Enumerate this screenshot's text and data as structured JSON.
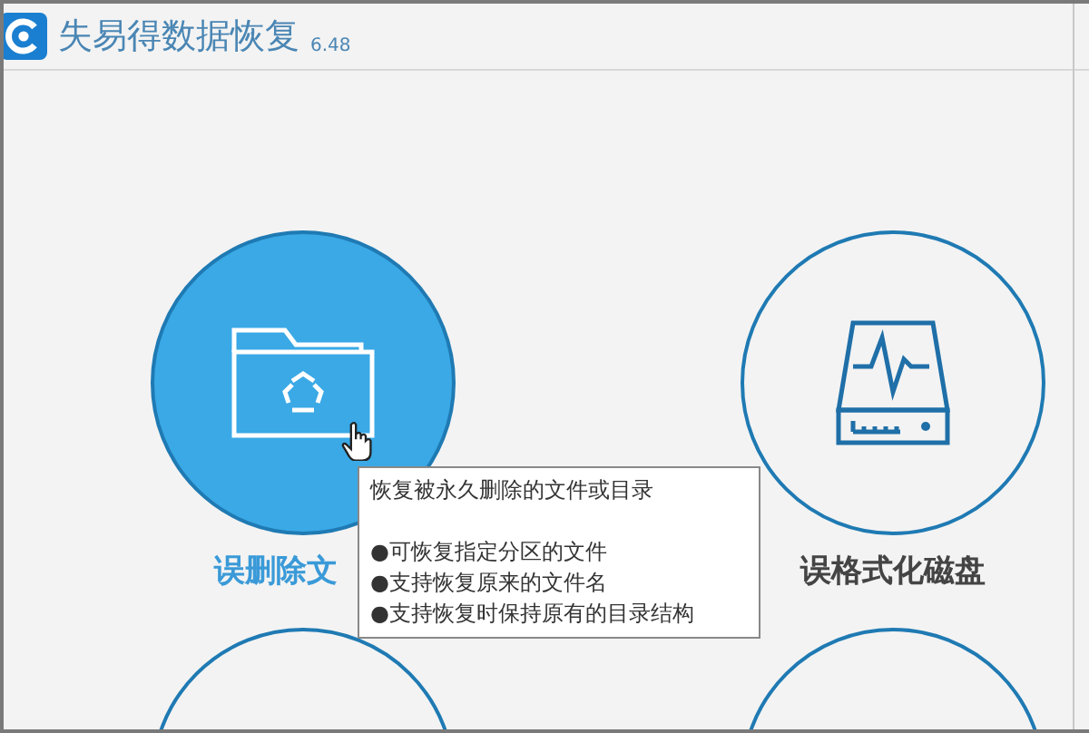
{
  "window": {
    "title": "失易得数据恢复",
    "version": "6.48"
  },
  "cards": [
    {
      "kind": "folder",
      "label": "误删除文",
      "selected": true
    },
    {
      "kind": "disk",
      "label": "误格式化磁盘",
      "selected": false
    },
    {
      "kind": "hidden",
      "selected": false
    },
    {
      "kind": "hidden",
      "selected": false
    }
  ],
  "tooltip": {
    "title": "恢复被永久删除的文件或目录",
    "bullet": "●",
    "items": [
      "可恢复指定分区的文件",
      "支持恢复原来的文件名",
      "支持恢复时保持原有的目录结构"
    ]
  }
}
